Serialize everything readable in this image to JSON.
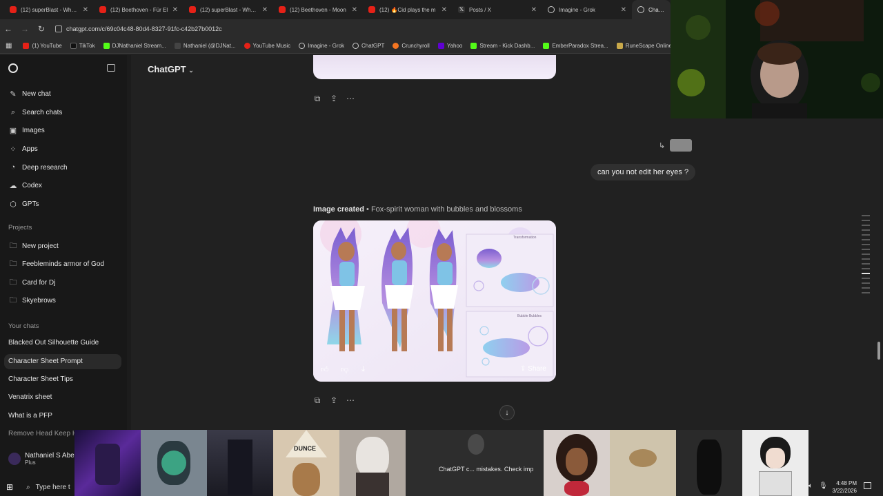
{
  "tabs": [
    {
      "label": "(12) superBlast - What..",
      "color": "#e62117"
    },
    {
      "label": "(12) Beethoven - Für El",
      "color": "#e62117"
    },
    {
      "label": "(12) superBlast - Where",
      "color": "#e62117"
    },
    {
      "label": "(12) Beethoven - Moon",
      "color": "#e62117"
    },
    {
      "label": "(12) 🔥Cid plays the m",
      "color": "#e62117"
    },
    {
      "label": "Posts / X",
      "color": "#ffffff"
    },
    {
      "label": "Imagine - Grok",
      "color": "#ffffff"
    },
    {
      "label": "Character",
      "color": "#ffffff"
    }
  ],
  "url": "chatgpt.com/c/69c04c48-80d4-8327-91fc-c42b27b0012c",
  "bookmarks": [
    {
      "label": "(1) YouTube",
      "color": "#e62117"
    },
    {
      "label": "TikTok",
      "color": "#ffffff"
    },
    {
      "label": "DJNathaniel Stream...",
      "color": "#53fc18"
    },
    {
      "label": "Nathaniel (@DJNat...",
      "color": "#ffffff"
    },
    {
      "label": "YouTube Music",
      "color": "#e62117"
    },
    {
      "label": "Imagine - Grok",
      "color": "#ffffff"
    },
    {
      "label": "ChatGPT",
      "color": "#ffffff"
    },
    {
      "label": "Crunchyroll",
      "color": "#f47521"
    },
    {
      "label": "Yahoo",
      "color": "#6001d2"
    },
    {
      "label": "Stream - Kick Dashb...",
      "color": "#53fc18"
    },
    {
      "label": "EmberParadox Strea...",
      "color": "#53fc18"
    },
    {
      "label": "RuneScape Online",
      "color": "#c9a94a"
    }
  ],
  "sidebar": {
    "nav": [
      {
        "label": "New chat",
        "icon": "edit-icon"
      },
      {
        "label": "Search chats",
        "icon": "search-icon"
      },
      {
        "label": "Images",
        "icon": "image-icon"
      },
      {
        "label": "Apps",
        "icon": "apps-icon"
      },
      {
        "label": "Deep research",
        "icon": "research-icon"
      },
      {
        "label": "Codex",
        "icon": "codex-icon"
      },
      {
        "label": "GPTs",
        "icon": "gpts-icon"
      }
    ],
    "projects_heading": "Projects",
    "projects": [
      {
        "label": "New project",
        "icon": "folder-plus-icon"
      },
      {
        "label": "Feebleminds armor of God",
        "icon": "folder-icon"
      },
      {
        "label": "Card for Dj",
        "icon": "folder-icon"
      },
      {
        "label": "Skyebrows",
        "icon": "folder-icon"
      }
    ],
    "chats_heading": "Your chats",
    "chats": [
      "Blacked Out Silhouette Guide",
      "Character Sheet Prompt",
      "Character Sheet Tips",
      "Venatrix sheet",
      "What is a PFP",
      "Remove Head Keep H"
    ],
    "user_name": "Nathaniel S Abe",
    "user_plan": "Plus"
  },
  "main": {
    "model_label": "ChatGPT",
    "user_message": "can you not edit her eyes ?",
    "image_created_label": "Image created",
    "image_title": "• Fox-spirit woman with bubbles and blossoms",
    "share_label": "Share",
    "image_caption_top": "Transformation",
    "image_caption_bottom": "Bubble Bubbles"
  },
  "toast": "ChatGPT c... mistakes. Check imp",
  "taskbar": {
    "search_placeholder": "Type here t",
    "time": "4:48 PM",
    "date": "3/22/2026"
  },
  "thumb_text": "DUNCE"
}
